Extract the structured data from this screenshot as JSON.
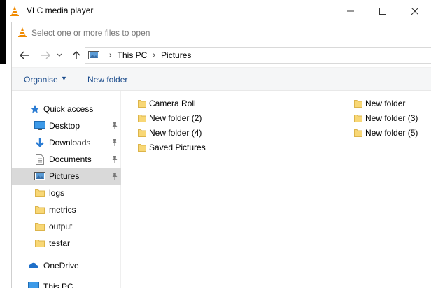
{
  "window": {
    "title": "VLC media player",
    "minimize_icon": "minimize-icon",
    "maximize_icon": "maximize-icon",
    "close_icon": "close-icon"
  },
  "dialog": {
    "title": "Select one or more files to open"
  },
  "navigation": {
    "back_icon": "back-arrow-icon",
    "forward_icon": "forward-arrow-icon",
    "recent_icon": "chevron-down-icon",
    "up_icon": "up-arrow-icon"
  },
  "address": {
    "crumbs": [
      "This PC",
      "Pictures"
    ]
  },
  "toolbar": {
    "organise_label": "Organise",
    "new_folder_label": "New folder"
  },
  "sidebar": {
    "items": [
      {
        "label": "Quick access",
        "icon": "star-icon"
      },
      {
        "label": "Desktop",
        "icon": "desktop-icon",
        "pinned": true
      },
      {
        "label": "Downloads",
        "icon": "download-icon",
        "pinned": true
      },
      {
        "label": "Documents",
        "icon": "documents-icon",
        "pinned": true
      },
      {
        "label": "Pictures",
        "icon": "pictures-icon",
        "pinned": true,
        "selected": true
      },
      {
        "label": "logs",
        "icon": "folder-icon"
      },
      {
        "label": "metrics",
        "icon": "folder-icon"
      },
      {
        "label": "output",
        "icon": "folder-icon"
      },
      {
        "label": "testar",
        "icon": "folder-icon"
      },
      {
        "label": "OneDrive",
        "icon": "cloud-icon"
      },
      {
        "label": "This PC",
        "icon": "computer-icon"
      }
    ]
  },
  "content": {
    "items": [
      {
        "label": "Camera Roll"
      },
      {
        "label": "New folder (2)"
      },
      {
        "label": "New folder (4)"
      },
      {
        "label": "Saved Pictures"
      },
      {
        "label": "New folder"
      },
      {
        "label": "New folder (3)"
      },
      {
        "label": "New folder (5)"
      }
    ]
  },
  "colors": {
    "accent": "#1a4b8c",
    "folder": "#f8d775",
    "selected_row": "#d9d9d9"
  }
}
